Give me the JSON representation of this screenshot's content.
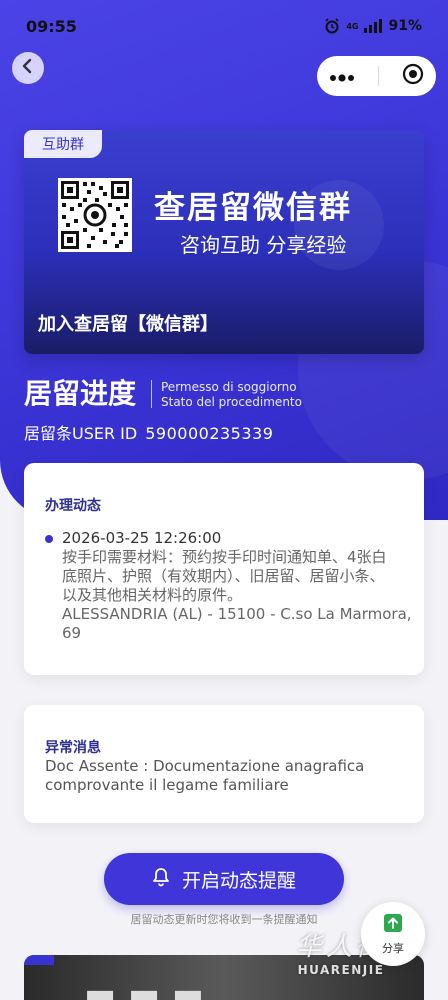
{
  "status_bar": {
    "time": "09:55",
    "network": "4G",
    "battery": "91%"
  },
  "banner": {
    "tag": "互助群",
    "title": "查居留微信群",
    "subtitle": "咨询互助 分享经验",
    "join_text": "加入查居留【微信群】"
  },
  "progress": {
    "title": "居留进度",
    "subtitle_line1": "Permesso di soggiorno",
    "subtitle_line2": "Stato del procedimento",
    "user_id_label": "居留条USER ID",
    "user_id_value": "590000235339"
  },
  "activity": {
    "heading": "办理动态",
    "entry": {
      "date": "2026-03-25 12:26:00",
      "text_line1": "按手印需要材料：预约按手印时间通知单、4张白",
      "text_line2": "底照片、护照（有效期内）、旧居留、居留小条、",
      "text_line3": "以及其他相关材料的原件。",
      "address_line1": "ALESSANDRIA (AL) - 15100 - C.so La Marmora,",
      "address_line2": "69"
    }
  },
  "alert": {
    "heading": "异常消息",
    "line1": "Doc Assente : Documentazione anagrafica",
    "line2": "comprovante il legame familiare"
  },
  "remind": {
    "button_label": "开启动态提醒",
    "note": "居留动态更新时您将收到一条提醒通知"
  },
  "share": {
    "label": "分享"
  },
  "watermark": {
    "cn": "华人街",
    "en": "HUARENJIE"
  },
  "colors": {
    "primary": "#3f35d8",
    "heading": "#2f3093",
    "background": "#f3f3f7"
  }
}
